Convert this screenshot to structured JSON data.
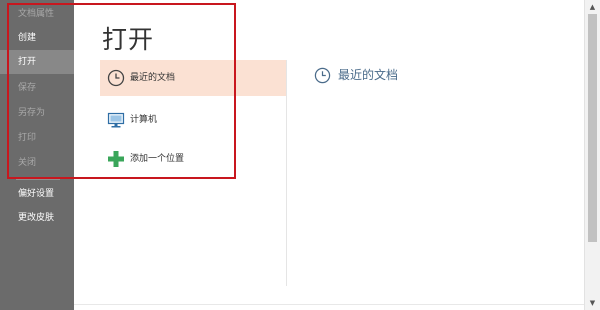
{
  "sidebar": {
    "items": [
      {
        "label": "文档属性",
        "state": "disabled"
      },
      {
        "label": "创建",
        "state": "normal"
      },
      {
        "label": "打开",
        "state": "active"
      },
      {
        "label": "保存",
        "state": "disabled"
      },
      {
        "label": "另存为",
        "state": "disabled"
      },
      {
        "label": "打印",
        "state": "disabled"
      },
      {
        "label": "关闭",
        "state": "disabled"
      }
    ],
    "bottom_items": [
      {
        "label": "偏好设置"
      },
      {
        "label": "更改皮肤"
      }
    ]
  },
  "main": {
    "title": "打开",
    "locations": [
      {
        "label": "最近的文档",
        "icon": "clock-icon",
        "selected": true
      },
      {
        "label": "计算机",
        "icon": "computer-icon",
        "selected": false
      },
      {
        "label": "添加一个位置",
        "icon": "plus-icon",
        "selected": false
      }
    ],
    "right_panel": {
      "header": "最近的文档",
      "icon": "clock-icon"
    }
  },
  "colors": {
    "sidebar_bg": "#6b6b6b",
    "active_item_bg": "#888888",
    "selected_location_bg": "#fbe1d3",
    "plus_icon": "#3aa65a",
    "highlight_frame": "#c8171e",
    "recent_header_text": "#4a6b8a"
  }
}
